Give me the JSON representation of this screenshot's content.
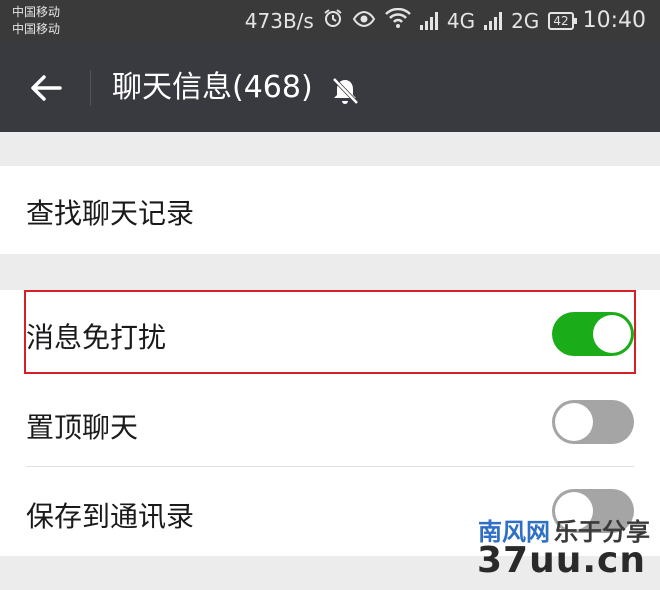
{
  "status_bar": {
    "carrier_1": "中国移动",
    "carrier_2": "中国移动",
    "net_speed": "473B/s",
    "network_1": "4G",
    "network_2": "2G",
    "battery": "42",
    "time": "10:40"
  },
  "header": {
    "title": "聊天信息(468)"
  },
  "settings": {
    "search_history_label": "查找聊天记录",
    "do_not_disturb_label": "消息免打扰",
    "do_not_disturb_on": true,
    "sticky_label": "置顶聊天",
    "sticky_on": false,
    "save_to_contacts_label": "保存到通讯录",
    "save_to_contacts_on": false
  },
  "colors": {
    "toggle_on": "#1aad19",
    "toggle_off": "#a5a5a5",
    "highlight_border": "#d5202a",
    "header_bg": "#393a3f"
  },
  "watermark": {
    "site": "南风网",
    "name": "乐于分享",
    "domain": "37uu.cn"
  }
}
